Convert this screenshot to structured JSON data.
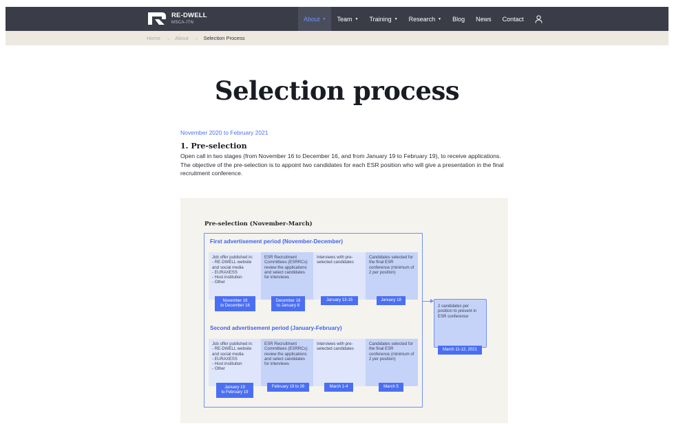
{
  "header": {
    "logo_title": "RE-DWELL",
    "logo_subtitle": "MSCA-ITN",
    "nav": [
      {
        "label": "About",
        "dropdown": true,
        "active": true
      },
      {
        "label": "Team",
        "dropdown": true
      },
      {
        "label": "Training",
        "dropdown": true
      },
      {
        "label": "Research",
        "dropdown": true
      },
      {
        "label": "Blog",
        "dropdown": false
      },
      {
        "label": "News",
        "dropdown": false
      },
      {
        "label": "Contact",
        "dropdown": false
      }
    ],
    "caret": "▼",
    "user_icon": "user-icon"
  },
  "breadcrumb": {
    "items": [
      "Home",
      "About",
      "Selection Process"
    ],
    "separator": "→"
  },
  "main": {
    "title": "Selection process",
    "date_range": "November 2020 to February 2021",
    "section_heading": "1. Pre-selection",
    "section_body": "Open call in two stages (from November 16 to December 16, and from January 19 to February 19), to receive applications. The objective of the pre-selection is to appoint two candidates for each ESR position who will give a presentation in the final recruitment conference."
  },
  "diagram": {
    "title": "Pre-selection (November-March)",
    "periods": [
      {
        "title": "First advertisement period (November-December)",
        "steps": [
          "Job offer published in:\n- RE-DWELL website and social media\n- EURAXESS\n- Host institution\n- Other",
          "ESR Recruitment Committees (ESRRCs) review the applications and select candidates for interviews",
          "Interviews with pre-selected candidates",
          "Candidates selected for the final ESR conference (minimum of 2 per position)"
        ],
        "dates": [
          "November 16\nto December 16",
          "December 16\nto January 8",
          "January 13-15",
          "January 18"
        ]
      },
      {
        "title": "Second advertisement period (January-February)",
        "steps": [
          "Job offer published in:\n- RE-DWELL website and social media\n- EURAXESS\n- Host institution\n- Other",
          "ESR Recruitment Committees (ESRRCs) review the applications and select candidates for interviews",
          "Interviews with pre-selected candidates",
          "Candidates selected for the final ESR conference (minimum of 2 per position)"
        ],
        "dates": [
          "January 19\nto February 19",
          "February 19 to 26",
          "March 1-4",
          "March 5"
        ]
      }
    ],
    "result": {
      "text": "2 candidates per position to present in ESR conference",
      "date": "March 11-12, 2021"
    },
    "colors": {
      "accent": "#4b6ff2",
      "step_light": "#dfe6fb",
      "step_dark": "#c6d3f8",
      "frame": "#6f8ff5",
      "panel_bg": "#f5f3ee"
    }
  }
}
